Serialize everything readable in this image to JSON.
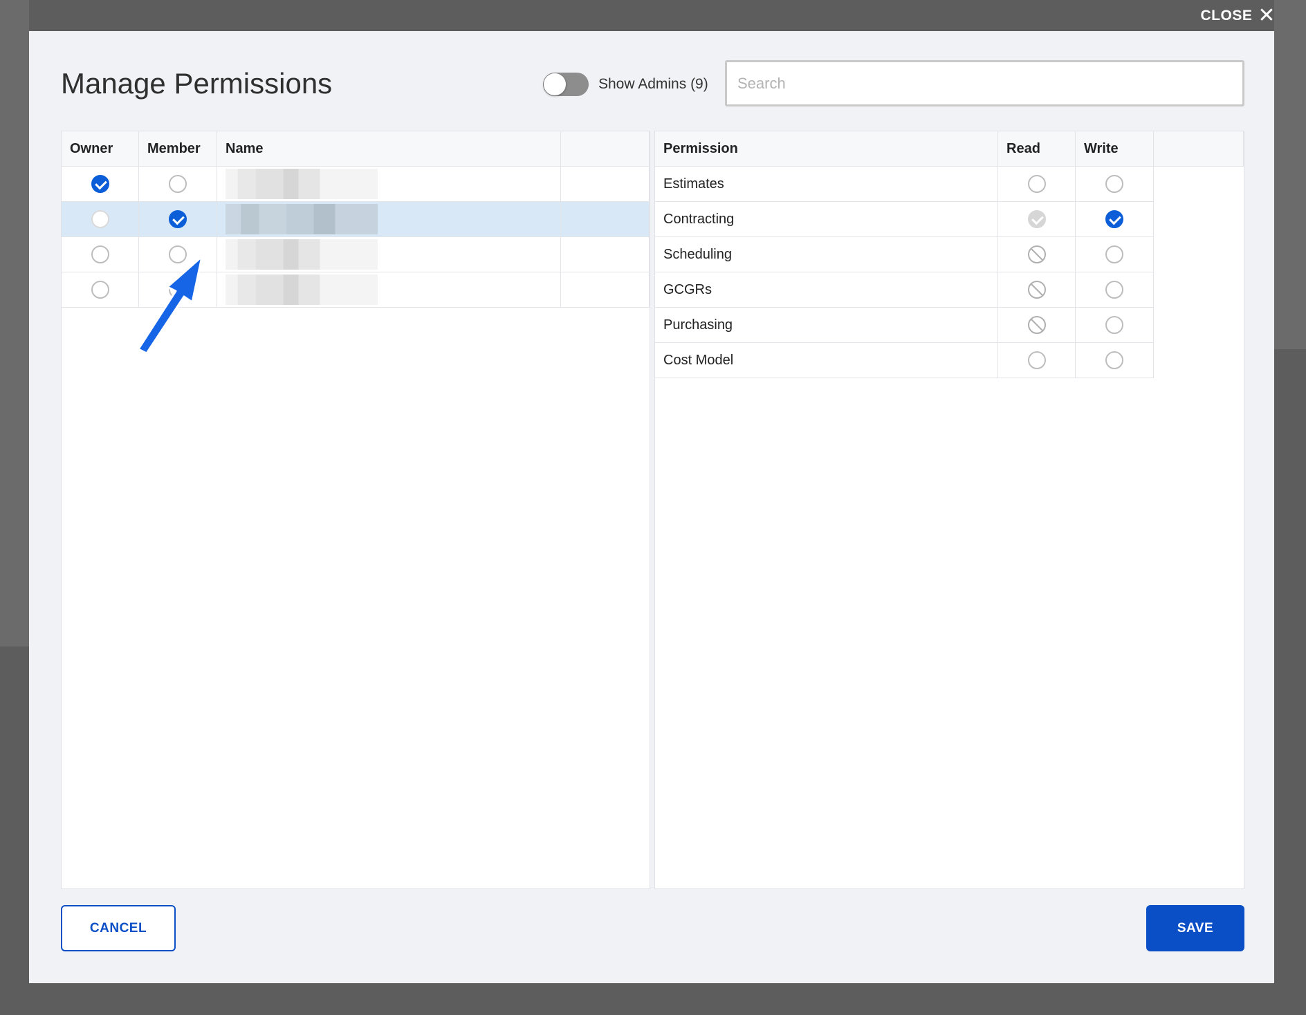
{
  "close": {
    "label": "CLOSE"
  },
  "dialog": {
    "title": "Manage Permissions",
    "show_admins_label": "Show Admins (9)",
    "show_admins_on": false,
    "search_placeholder": "Search"
  },
  "members_table": {
    "columns": [
      "Owner",
      "Member",
      "Name"
    ],
    "rows": [
      {
        "owner": true,
        "member": false,
        "name_blurred": true
      },
      {
        "owner": false,
        "member": true,
        "name_blurred": true,
        "selected": true
      },
      {
        "owner": false,
        "member": false,
        "name_blurred": true
      },
      {
        "owner": false,
        "member": false,
        "name_blurred": true
      }
    ]
  },
  "permissions_table": {
    "columns": [
      "Permission",
      "Read",
      "Write"
    ],
    "rows": [
      {
        "name": "Estimates",
        "read": "unchecked",
        "write": "unchecked"
      },
      {
        "name": "Contracting",
        "read": "checked-disabled",
        "write": "checked"
      },
      {
        "name": "Scheduling",
        "read": "blocked",
        "write": "unchecked"
      },
      {
        "name": "GCGRs",
        "read": "blocked",
        "write": "unchecked"
      },
      {
        "name": "Purchasing",
        "read": "blocked",
        "write": "unchecked"
      },
      {
        "name": "Cost Model",
        "read": "unchecked",
        "write": "unchecked"
      }
    ]
  },
  "buttons": {
    "cancel": "CANCEL",
    "save": "SAVE"
  },
  "colors": {
    "accent": "#0b4fc6",
    "check": "#0b5ed7",
    "selected_row": "#d9e8f7"
  }
}
